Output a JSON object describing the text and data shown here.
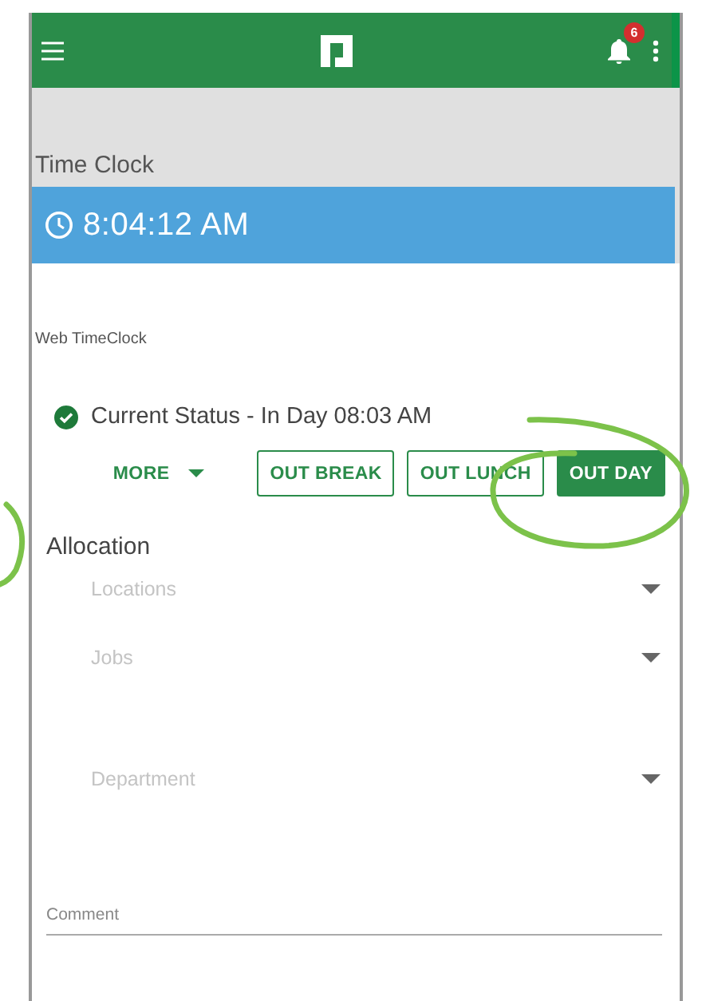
{
  "app_bar": {
    "notification_count": "6"
  },
  "section_title": "Time Clock",
  "clock": {
    "time": "8:04:12 AM"
  },
  "card": {
    "title": "Web TimeClock",
    "status": {
      "text": "Current Status - In Day 08:03 AM"
    },
    "actions": [
      {
        "label": "MORE",
        "kind": "menu"
      },
      {
        "label": "OUT BREAK",
        "kind": "outlined"
      },
      {
        "label": "OUT LUNCH",
        "kind": "outlined"
      },
      {
        "label": "OUT DAY",
        "kind": "filled"
      }
    ],
    "allocation": {
      "title": "Allocation",
      "fields": [
        {
          "placeholder": "Locations"
        },
        {
          "placeholder": "Jobs"
        },
        {
          "placeholder": "Department"
        }
      ]
    },
    "comment": {
      "placeholder": "Comment"
    }
  },
  "annotations": [
    {
      "kind": "circle"
    },
    {
      "kind": "circle"
    }
  ]
}
